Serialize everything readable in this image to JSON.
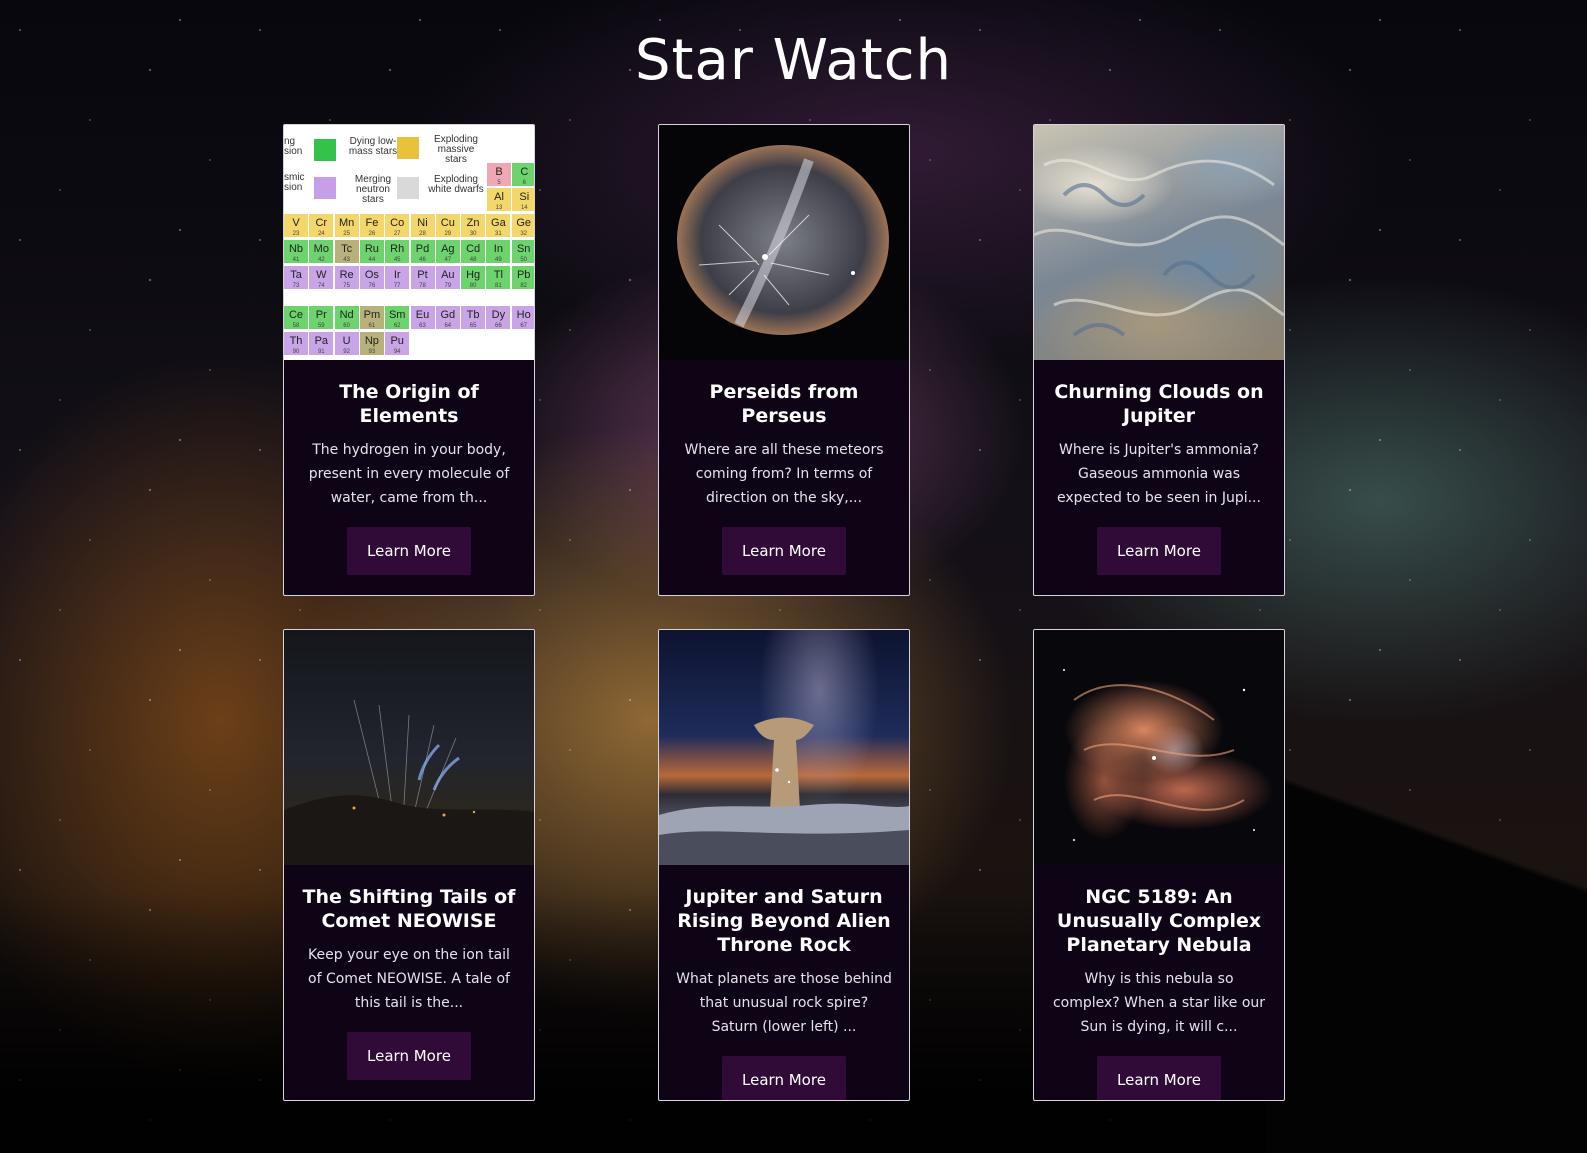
{
  "site": {
    "title": "Star Watch"
  },
  "cards": [
    {
      "title": "The Origin of Elements",
      "description": "The hydrogen in your body, present in every molecule of water, came from th...",
      "button": "Learn More",
      "image_icon": "periodic-table-image"
    },
    {
      "title": "Perseids from Perseus",
      "description": "Where are all these meteors coming from? In terms of direction on the sky,...",
      "button": "Learn More",
      "image_icon": "meteor-shower-image"
    },
    {
      "title": "Churning Clouds on Jupiter",
      "description": "Where is Jupiter's ammonia? Gaseous ammonia was expected to be seen in Jupi...",
      "button": "Learn More",
      "image_icon": "jupiter-clouds-image"
    },
    {
      "title": "The Shifting Tails of Comet NEOWISE",
      "description": "Keep your eye on the ion tail of Comet NEOWISE. A tale of this tail is the...",
      "button": "Learn More",
      "image_icon": "comet-image"
    },
    {
      "title": "Jupiter and Saturn Rising Beyond Alien Throne Rock",
      "description": "What planets are those behind that unusual rock spire? Saturn (lower left) ...",
      "button": "Learn More",
      "image_icon": "rock-spire-milky-way-image"
    },
    {
      "title": "NGC 5189: An Unusually Complex Planetary Nebula",
      "description": "Why is this nebula so complex? When a star like our Sun is dying, it will c...",
      "button": "Learn More",
      "image_icon": "nebula-image"
    }
  ],
  "periodic_table": {
    "legend": [
      {
        "label": "Dying low-mass stars",
        "color": "#33c24a"
      },
      {
        "label": "Exploding massive stars",
        "color": "#e9c23a"
      },
      {
        "label": "Merging neutron stars",
        "color": "#c79fe8"
      },
      {
        "label": "Exploding white dwarfs",
        "color": "#d9d9d9"
      }
    ],
    "legend_fragments": [
      "ng",
      "sion",
      "smic",
      "sion"
    ],
    "rows": [
      [
        [
          "B",
          "5"
        ],
        [
          "C",
          "6"
        ]
      ],
      [
        [
          "Al",
          "13"
        ],
        [
          "Si",
          "14"
        ]
      ],
      [
        [
          "V",
          "23"
        ],
        [
          "Cr",
          "24"
        ],
        [
          "Mn",
          "25"
        ],
        [
          "Fe",
          "26"
        ],
        [
          "Co",
          "27"
        ],
        [
          "Ni",
          "28"
        ],
        [
          "Cu",
          "29"
        ],
        [
          "Zn",
          "30"
        ],
        [
          "Ga",
          "31"
        ],
        [
          "Ge",
          "32"
        ]
      ],
      [
        [
          "Nb",
          "41"
        ],
        [
          "Mo",
          "42"
        ],
        [
          "Tc",
          "43"
        ],
        [
          "Ru",
          "44"
        ],
        [
          "Rh",
          "45"
        ],
        [
          "Pd",
          "46"
        ],
        [
          "Ag",
          "47"
        ],
        [
          "Cd",
          "48"
        ],
        [
          "In",
          "49"
        ],
        [
          "Sn",
          "50"
        ]
      ],
      [
        [
          "Ta",
          "73"
        ],
        [
          "W",
          "74"
        ],
        [
          "Re",
          "75"
        ],
        [
          "Os",
          "76"
        ],
        [
          "Ir",
          "77"
        ],
        [
          "Pt",
          "78"
        ],
        [
          "Au",
          "79"
        ],
        [
          "Hg",
          "80"
        ],
        [
          "Tl",
          "81"
        ],
        [
          "Pb",
          "82"
        ]
      ],
      [
        [
          "Ce",
          "58"
        ],
        [
          "Pr",
          "59"
        ],
        [
          "Nd",
          "60"
        ],
        [
          "Pm",
          "61"
        ],
        [
          "Sm",
          "62"
        ],
        [
          "Eu",
          "63"
        ],
        [
          "Gd",
          "64"
        ],
        [
          "Tb",
          "65"
        ],
        [
          "Dy",
          "66"
        ],
        [
          "Ho",
          "67"
        ]
      ],
      [
        [
          "Th",
          "90"
        ],
        [
          "Pa",
          "91"
        ],
        [
          "U",
          "92"
        ],
        [
          "Np",
          "93"
        ],
        [
          "Pu",
          "94"
        ]
      ]
    ]
  }
}
